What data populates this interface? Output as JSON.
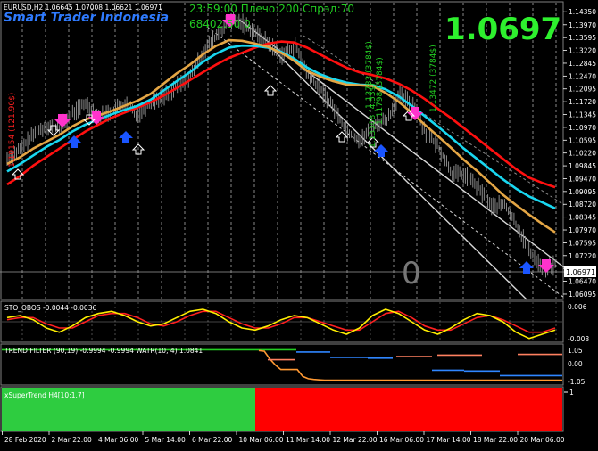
{
  "header": {
    "symbol_info": "EURUSD,H2  1.06645 1.07008 1.06621 1.06971",
    "brand": "Smart Trader Indonesia",
    "info_line1": "23:59:00 Плечо:200 Спрэд:70",
    "info_line2": "68402.50 0",
    "big_price": "1.0697",
    "counter": "0"
  },
  "colors": {
    "background": "#000000",
    "grid": "#ffffff",
    "axis_text": "#ffffff",
    "brand": "#2f7bff",
    "info": "#22cc22",
    "big_price": "#2ef02e",
    "candle": "#8c8c8c",
    "red_ma": "#ff1010",
    "cyan_ma": "#19d7f0",
    "orange_ma": "#e4a645",
    "channel": "#d8d8d8",
    "macd_red": "#ff2020",
    "macd_yellow": "#ffee00",
    "trend_green": "#22cc22",
    "trend_orange": "#ff9933",
    "trend_blue": "#2f86ff",
    "trend_salmon": "#ff8060",
    "st_green": "#2ecc40",
    "st_red": "#ff0000"
  },
  "chart_data": [
    {
      "type": "line",
      "name": "price-main",
      "title": "EURUSD,H2",
      "y_ticks": [
        1.1435,
        1.1397,
        1.13595,
        1.1322,
        1.12845,
        1.1247,
        1.12095,
        1.1172,
        1.11345,
        1.1097,
        1.10595,
        1.1022,
        1.09845,
        1.0947,
        1.09095,
        1.0872,
        1.08345,
        1.0797,
        1.07595,
        1.0722,
        1.06845,
        1.0647,
        1.06095
      ],
      "ylim": [
        1.0599,
        1.1459
      ],
      "current_price": "1.06971",
      "y_tick_labels": [
        "1.14350",
        "1.13970",
        "1.13595",
        "1.13220",
        "1.12845",
        "1.12470",
        "1.12095",
        "1.11720",
        "1.11345",
        "1.10970",
        "1.10595",
        "1.10220",
        "1.09845",
        "1.09470",
        "1.09095",
        "1.08720",
        "1.08345",
        "1.07970",
        "1.07595",
        "1.07220",
        "1.06845",
        "1.06470",
        "1.06095"
      ],
      "annotations": [
        "1.10154 (121.90$)",
        "1.13308 (4.53$)",
        "1.11798 (3784$)",
        "1.13783 (3784$)",
        "1.13472 (3784$)"
      ],
      "series": [
        {
          "name": "Price",
          "values": [
            1.1005,
            1.1032,
            1.1075,
            1.1101,
            1.1095,
            1.1138,
            1.1168,
            1.1128,
            1.1145,
            1.1166,
            1.1134,
            1.1172,
            1.119,
            1.1218,
            1.1246,
            1.132,
            1.1365,
            1.141,
            1.1402,
            1.1372,
            1.134,
            1.1308,
            1.1335,
            1.1248,
            1.1205,
            1.115,
            1.1085,
            1.1058,
            1.1102,
            1.112,
            1.119,
            1.1165,
            1.108,
            1.1036,
            1.0962,
            1.0958,
            1.092,
            1.0865,
            1.0872,
            1.0805,
            1.073,
            1.0683,
            1.0697
          ]
        },
        {
          "name": "Red MA",
          "values": [
            1.093,
            1.0955,
            1.0985,
            1.101,
            1.1035,
            1.106,
            1.1085,
            1.1105,
            1.1125,
            1.114,
            1.1155,
            1.117,
            1.119,
            1.1212,
            1.1235,
            1.1258,
            1.128,
            1.13,
            1.1315,
            1.133,
            1.1342,
            1.1348,
            1.1345,
            1.133,
            1.131,
            1.129,
            1.1272,
            1.1258,
            1.125,
            1.124,
            1.1225,
            1.1205,
            1.118,
            1.1152,
            1.1125,
            1.1095,
            1.1065,
            1.1035,
            1.1005,
            1.0975,
            1.095,
            1.0935,
            1.0922
          ]
        },
        {
          "name": "Cyan MA",
          "values": [
            1.0968,
            1.099,
            1.1015,
            1.104,
            1.106,
            1.1085,
            1.1105,
            1.112,
            1.1135,
            1.1148,
            1.116,
            1.1178,
            1.1205,
            1.1232,
            1.1258,
            1.1288,
            1.1312,
            1.133,
            1.1336,
            1.1335,
            1.133,
            1.1318,
            1.1298,
            1.1272,
            1.1252,
            1.1238,
            1.1228,
            1.1222,
            1.122,
            1.1208,
            1.1188,
            1.116,
            1.113,
            1.11,
            1.1068,
            1.1035,
            1.1005,
            1.0975,
            1.0945,
            1.0918,
            1.0895,
            1.0878,
            1.086
          ]
        },
        {
          "name": "Orange MA",
          "values": [
            1.099,
            1.101,
            1.1035,
            1.1055,
            1.1075,
            1.11,
            1.112,
            1.1132,
            1.1145,
            1.116,
            1.1175,
            1.1195,
            1.1225,
            1.1255,
            1.128,
            1.131,
            1.1335,
            1.1352,
            1.135,
            1.1342,
            1.1332,
            1.1315,
            1.1292,
            1.1262,
            1.1245,
            1.1232,
            1.1222,
            1.122,
            1.1218,
            1.1198,
            1.1172,
            1.114,
            1.1105,
            1.1072,
            1.1038,
            1.1002,
            1.097,
            1.0935,
            1.09,
            1.087,
            1.0842,
            1.0815,
            1.079
          ]
        }
      ]
    },
    {
      "type": "line",
      "name": "stoch-panel",
      "title": "STO_OBOS -0.0044 -0.0036",
      "ylim": [
        -0.009,
        0.009
      ],
      "y_tick_labels": [
        "0.006",
        "-0.008"
      ],
      "series": [
        {
          "name": "yellow",
          "values": [
            0.002,
            0.003,
            0.001,
            -0.003,
            -0.005,
            -0.002,
            0.002,
            0.004,
            0.005,
            0.003,
            0.0,
            -0.002,
            -0.001,
            0.002,
            0.005,
            0.006,
            0.004,
            0.0,
            -0.003,
            -0.004,
            -0.002,
            0.001,
            0.003,
            0.002,
            -0.001,
            -0.004,
            -0.006,
            -0.003,
            0.003,
            0.006,
            0.004,
            0.0,
            -0.004,
            -0.006,
            -0.003,
            0.001,
            0.004,
            0.003,
            0.0,
            -0.005,
            -0.008,
            -0.006,
            -0.004
          ]
        },
        {
          "name": "red",
          "values": [
            0.001,
            0.002,
            0.002,
            -0.001,
            -0.003,
            -0.003,
            0.0,
            0.003,
            0.004,
            0.004,
            0.002,
            -0.001,
            -0.002,
            0.0,
            0.003,
            0.005,
            0.005,
            0.002,
            -0.001,
            -0.003,
            -0.003,
            -0.001,
            0.002,
            0.002,
            0.0,
            -0.002,
            -0.004,
            -0.004,
            0.0,
            0.004,
            0.005,
            0.002,
            -0.002,
            -0.004,
            -0.004,
            -0.001,
            0.002,
            0.003,
            0.001,
            -0.002,
            -0.005,
            -0.005,
            -0.003
          ]
        }
      ]
    },
    {
      "type": "line",
      "name": "trend-filter-panel",
      "title": "TREND FILTER (90,19) -0.9994 -0.9994  WATR(10, 4) 1.0841",
      "ylim": [
        -1.2,
        1.2
      ],
      "y_tick_labels": [
        "1.05",
        "0.00",
        "-1.05"
      ],
      "series": [
        {
          "name": "green",
          "values": [
            1.0,
            1.0,
            1.0,
            1.0,
            1.0,
            1.0,
            1.0,
            1.0,
            1.0,
            1.0,
            1.0,
            1.0,
            1.0,
            1.0,
            1.0,
            1.0,
            1.0,
            1.0,
            1.0,
            1.0,
            1.0
          ]
        },
        {
          "name": "orange",
          "values": [
            0.95,
            0.9,
            0.4,
            0.0,
            -0.3,
            -0.3,
            -0.3,
            -0.3,
            -0.75,
            -0.9,
            -0.95,
            -0.98,
            -1.0,
            -1.0
          ]
        }
      ]
    },
    {
      "type": "bar",
      "name": "supertrend-panel",
      "title": "xSuperTrend H4[10;1.7]",
      "categories": [
        "up",
        "down"
      ],
      "values": [
        1,
        -1
      ]
    }
  ],
  "x_axis": {
    "labels": [
      "28 Feb 2020",
      "2 Mar 22:00",
      "4 Mar 06:00",
      "5 Mar 14:00",
      "6 Mar 22:00",
      "10 Mar 06:00",
      "11 Mar 14:00",
      "12 Mar 22:00",
      "16 Mar 06:00",
      "17 Mar 14:00",
      "18 Mar 22:00",
      "20 Mar 06:00"
    ]
  }
}
